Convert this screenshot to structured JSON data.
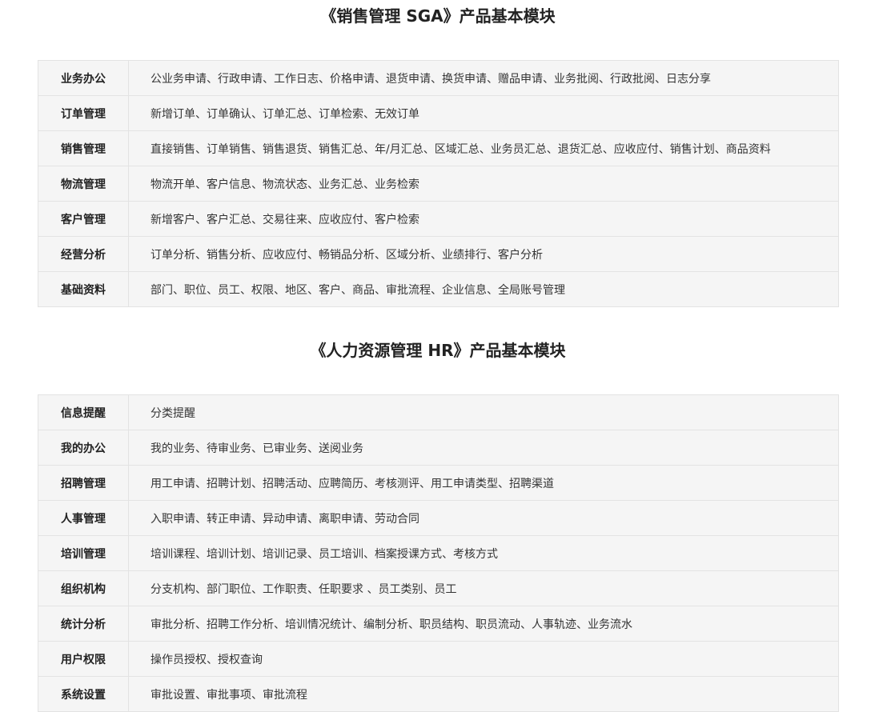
{
  "sga": {
    "title": "《销售管理 SGA》产品基本模块",
    "rows": [
      {
        "name": "业务办公",
        "items": "公业务申请、行政申请、工作日志、价格申请、退货申请、换货申请、赠品申请、业务批阅、行政批阅、日志分享"
      },
      {
        "name": "订单管理",
        "items": "新增订单、订单确认、订单汇总、订单检索、无效订单"
      },
      {
        "name": "销售管理",
        "items": "直接销售、订单销售、销售退货、销售汇总、年/月汇总、区域汇总、业务员汇总、退货汇总、应收应付、销售计划、商品资料"
      },
      {
        "name": "物流管理",
        "items": "物流开单、客户信息、物流状态、业务汇总、业务检索"
      },
      {
        "name": "客户管理",
        "items": "新增客户、客户汇总、交易往来、应收应付、客户检索"
      },
      {
        "name": "经营分析",
        "items": "订单分析、销售分析、应收应付、畅销品分析、区域分析、业绩排行、客户分析"
      },
      {
        "name": "基础资料",
        "items": "部门、职位、员工、权限、地区、客户、商品、审批流程、企业信息、全局账号管理"
      }
    ]
  },
  "hr": {
    "title": "《人力资源管理 HR》产品基本模块",
    "rows": [
      {
        "name": "信息提醒",
        "items": "分类提醒"
      },
      {
        "name": "我的办公",
        "items": "我的业务、待审业务、已审业务、送阅业务"
      },
      {
        "name": "招聘管理",
        "items": "用工申请、招聘计划、招聘活动、应聘简历、考核测评、用工申请类型、招聘渠道"
      },
      {
        "name": "人事管理",
        "items": "入职申请、转正申请、异动申请、离职申请、劳动合同"
      },
      {
        "name": "培训管理",
        "items": "培训课程、培训计划、培训记录、员工培训、档案授课方式、考核方式"
      },
      {
        "name": "组织机构",
        "items": "分支机构、部门职位、工作职责、任职要求 、员工类别、员工"
      },
      {
        "name": "统计分析",
        "items": "审批分析、招聘工作分析、培训情况统计、编制分析、职员结构、职员流动、人事轨迹、业务流水"
      },
      {
        "name": "用户权限",
        "items": "操作员授权、授权查询"
      },
      {
        "name": "系统设置",
        "items": "审批设置、审批事项、审批流程"
      }
    ]
  }
}
